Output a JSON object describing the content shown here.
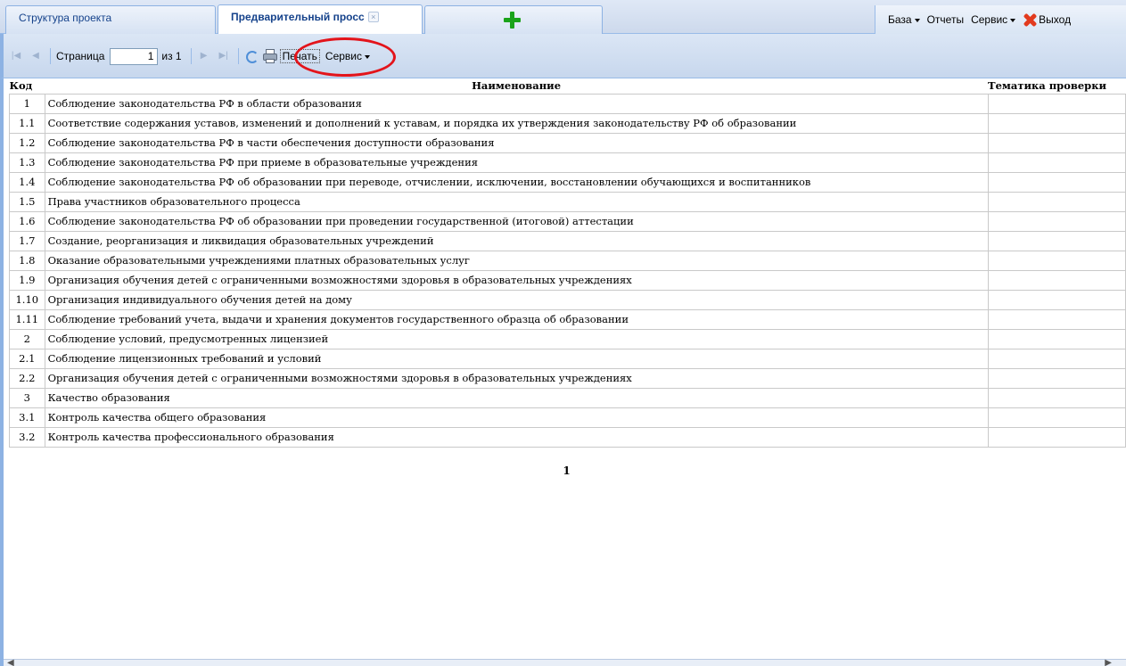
{
  "tabs": [
    {
      "label": "Структура проекта",
      "active": false
    },
    {
      "label": "Предварительный просс",
      "active": true
    }
  ],
  "add_tab_icon": "plus-icon",
  "top_menu": {
    "base": "База",
    "reports": "Отчеты",
    "service": "Сервис",
    "exit": "Выход"
  },
  "toolbar": {
    "page_label": "Страница",
    "page_value": "1",
    "of_label": "из 1",
    "print_label": "Печать",
    "service_label": "Сервис"
  },
  "report": {
    "headers": {
      "code": "Код",
      "name": "Наименование",
      "theme": "Тематика проверки"
    },
    "rows": [
      {
        "code": "1",
        "name": "Соблюдение законодательства РФ в области образования"
      },
      {
        "code": "1.1",
        "name": "Соответствие содержания уставов, изменений и дополнений к уставам, и порядка их утверждения законодательству РФ об образовании"
      },
      {
        "code": "1.2",
        "name": "Соблюдение законодательства РФ в части обеспечения доступности образования"
      },
      {
        "code": "1.3",
        "name": "Соблюдение законодательства РФ при приеме в образовательные учреждения"
      },
      {
        "code": "1.4",
        "name": "Соблюдение законодательства РФ об образовании при переводе, отчислении, исключении, восстановлении обучающихся и воспитанников"
      },
      {
        "code": "1.5",
        "name": "Права участников образовательного процесса"
      },
      {
        "code": "1.6",
        "name": "Соблюдение законодательства РФ об образовании при проведении государственной (итоговой) аттестации"
      },
      {
        "code": "1.7",
        "name": "Создание, реорганизация и ликвидация образовательных учреждений"
      },
      {
        "code": "1.8",
        "name": "Оказание образовательными учреждениями платных образовательных услуг"
      },
      {
        "code": "1.9",
        "name": "Организация обучения детей с ограниченными возможностями здоровья в образовательных учреждениях"
      },
      {
        "code": "1.10",
        "name": "Организация индивидуального обучения детей на дому"
      },
      {
        "code": "1.11",
        "name": "Соблюдение требований учета, выдачи и хранения документов государственного образца об образовании"
      },
      {
        "code": "2",
        "name": "Соблюдение условий, предусмотренных лицензией"
      },
      {
        "code": "2.1",
        "name": "Соблюдение лицензионных требований и условий"
      },
      {
        "code": "2.2",
        "name": "Организация обучения детей с ограниченными возможностями здоровья в образовательных учреждениях"
      },
      {
        "code": "3",
        "name": "Качество образования"
      },
      {
        "code": "3.1",
        "name": "Контроль качества общего образования"
      },
      {
        "code": "3.2",
        "name": "Контроль качества профессионального образования"
      }
    ],
    "page_number": "1"
  },
  "colors": {
    "highlight": "#e3141b",
    "accent": "#15428b"
  }
}
